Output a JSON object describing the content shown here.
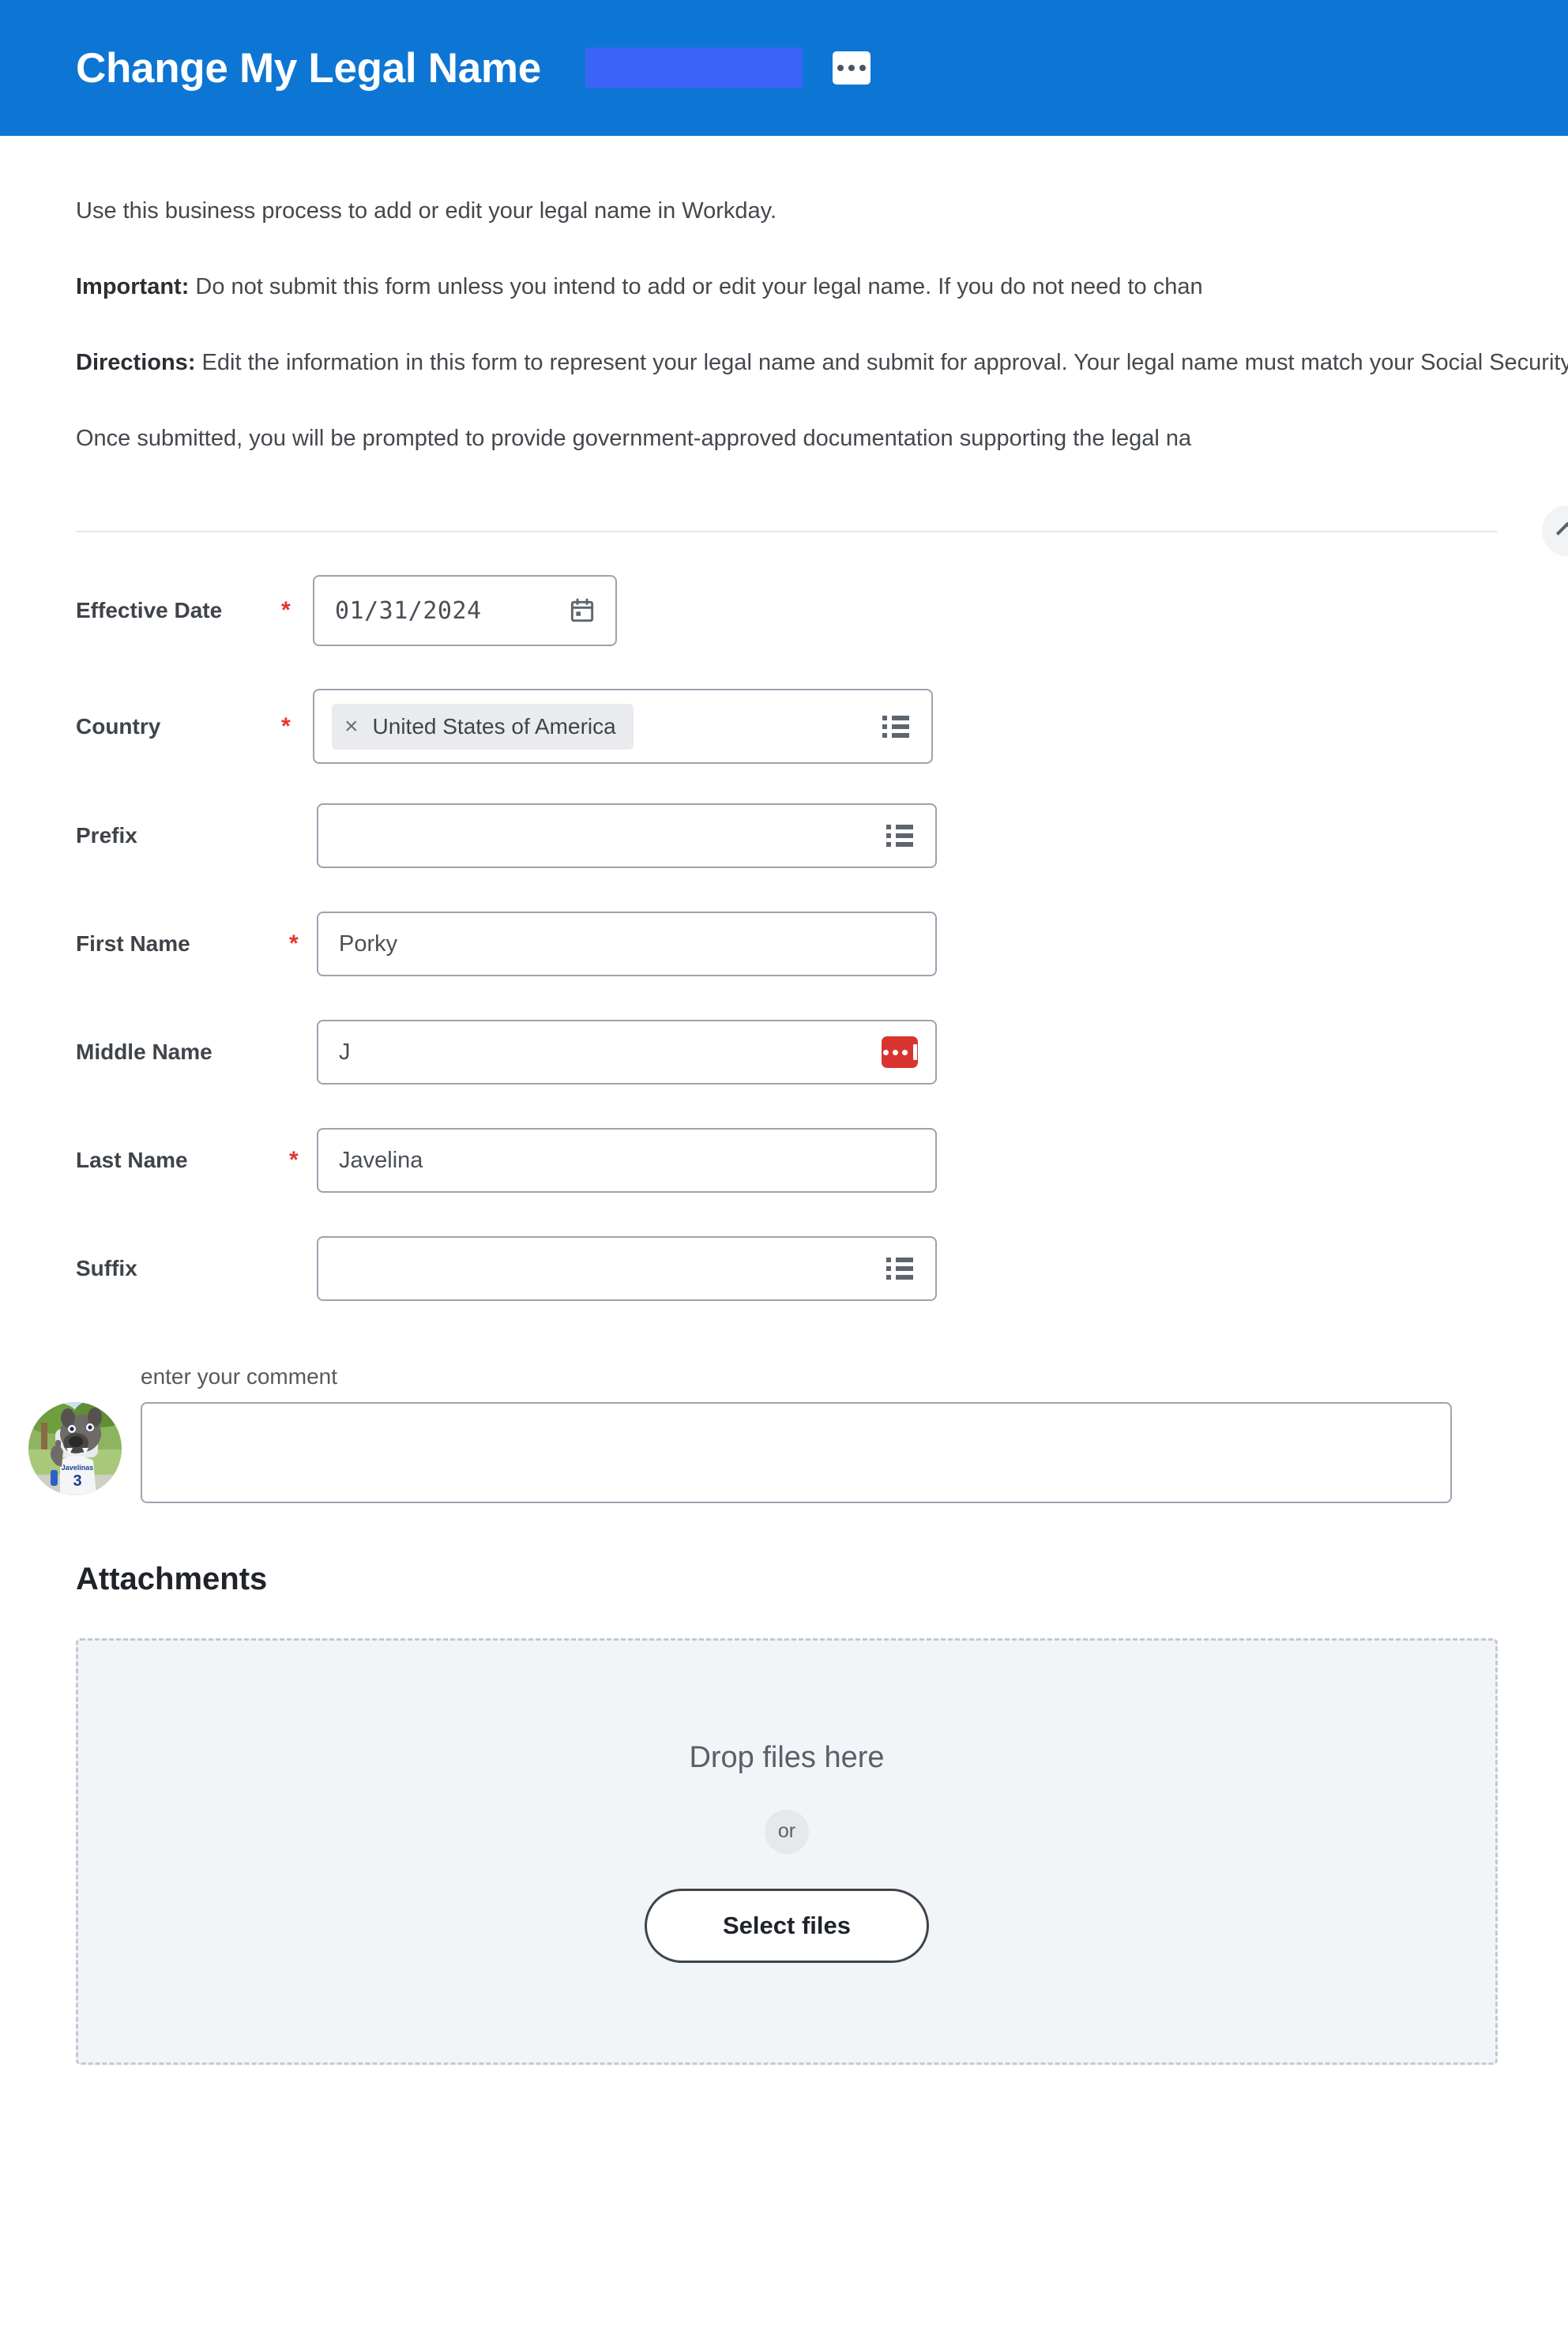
{
  "header": {
    "title": "Change My Legal Name",
    "redaction_color": "#3b63f6",
    "background_color": "#0d76d4",
    "more_actions_label": "•••"
  },
  "intro": {
    "line1": "Use this business process to add or edit your legal name in Workday.",
    "important_label": "Important:",
    "important_text": " Do not submit this form unless you intend to add or edit your legal name. If you do not need to chan",
    "directions_label": "Directions:",
    "directions_text": " Edit the information in this form to represent your legal name and submit for approval. Your legal name must match your Social Security card.",
    "line4": "Once submitted, you will be prompted to provide government-approved documentation supporting the legal na"
  },
  "form": {
    "required_marker": "*",
    "fields": {
      "effective_date": {
        "label": "Effective Date",
        "value": "01/31/2024",
        "required": true,
        "icon": "calendar-icon"
      },
      "country": {
        "label": "Country",
        "value": "United States of America",
        "required": true,
        "remove_label": "×",
        "icon": "prompt-list-icon"
      },
      "prefix": {
        "label": "Prefix",
        "value": "",
        "required": false,
        "icon": "prompt-list-icon"
      },
      "first_name": {
        "label": "First Name",
        "value": "Porky",
        "required": true
      },
      "middle_name": {
        "label": "Middle Name",
        "value": "J",
        "required": false,
        "badge_color": "#d8342f",
        "badge_icon": "masked-value-icon"
      },
      "last_name": {
        "label": "Last Name",
        "value": "Javelina",
        "required": true
      },
      "suffix": {
        "label": "Suffix",
        "value": "",
        "required": false,
        "icon": "prompt-list-icon"
      }
    }
  },
  "comment": {
    "label": "enter your comment",
    "value": "",
    "avatar_alt": "javelina-mascot-avatar"
  },
  "attachments": {
    "title": "Attachments",
    "drop_text": "Drop files here",
    "or_text": "or",
    "select_button": "Select files"
  },
  "collapse": {
    "icon": "chevron-up-icon"
  }
}
